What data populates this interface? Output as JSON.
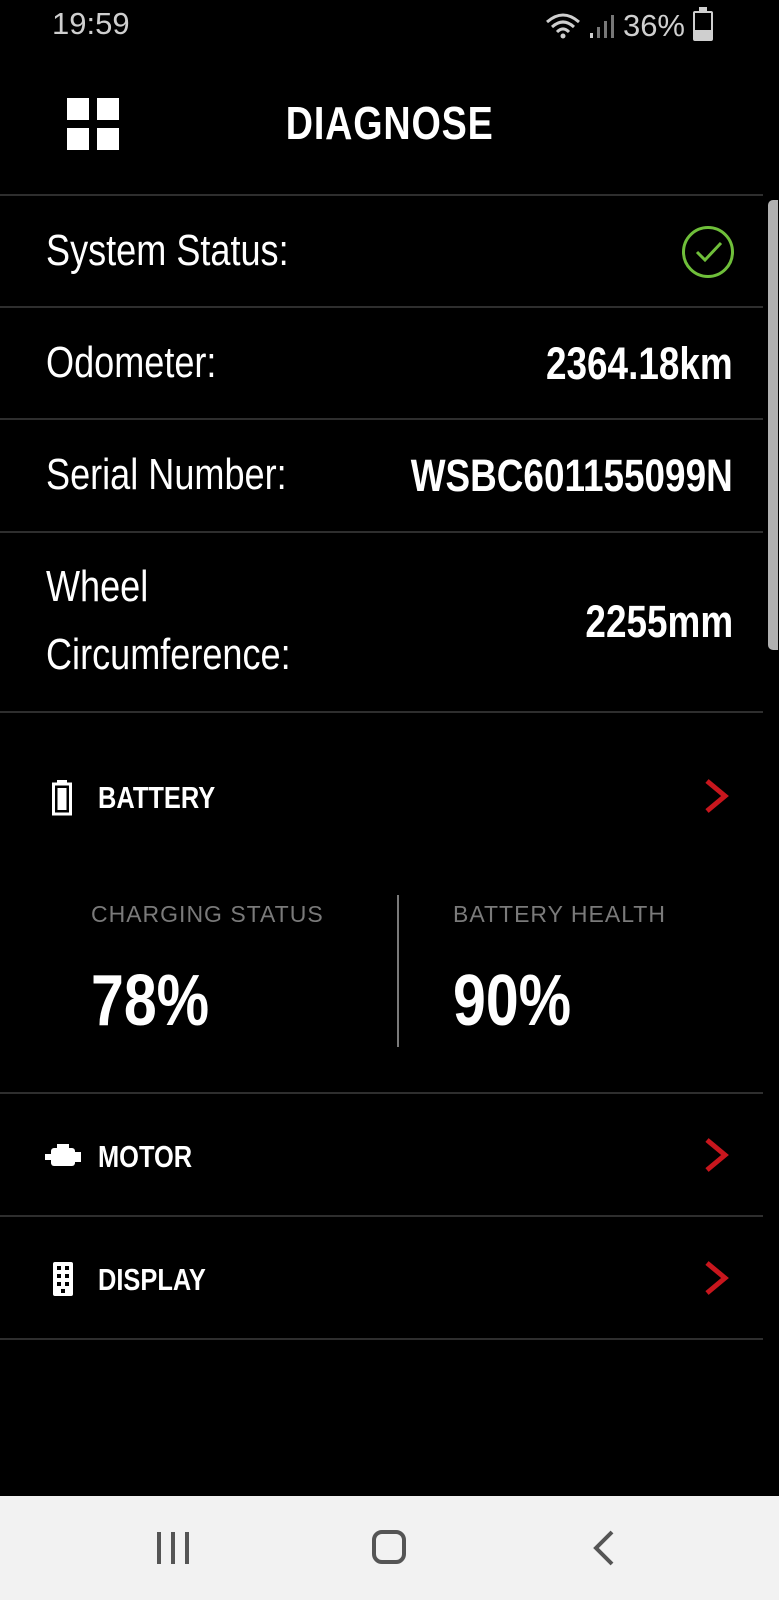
{
  "status_bar": {
    "time": "19:59",
    "battery_percent_text": "36%",
    "battery_level": 0.36,
    "icons": [
      "wifi-icon",
      "signal-icon",
      "battery-icon"
    ]
  },
  "header": {
    "title": "DIAGNOSE",
    "menu_icon": "grid-menu-icon"
  },
  "info": {
    "system_status_label": "System Status:",
    "system_status_icon": "check-circle-icon",
    "odometer_label": "Odometer:",
    "odometer_value": "2364.18km",
    "serial_label": "Serial Number:",
    "serial_value": "WSBC601155099N",
    "wheel_label_line1": "Wheel",
    "wheel_label_line2": "Circumference:",
    "wheel_value": "2255mm"
  },
  "battery": {
    "label": "BATTERY",
    "charging_title": "CHARGING STATUS",
    "charging_value": "78%",
    "health_title": "BATTERY HEALTH",
    "health_value": "90%"
  },
  "motor": {
    "label": "MOTOR"
  },
  "display": {
    "label": "DISPLAY"
  },
  "colors": {
    "background": "#000000",
    "accent_chevron": "#c8161d",
    "status_ok": "#6fbf3a",
    "muted_text": "#7a7a7a"
  }
}
